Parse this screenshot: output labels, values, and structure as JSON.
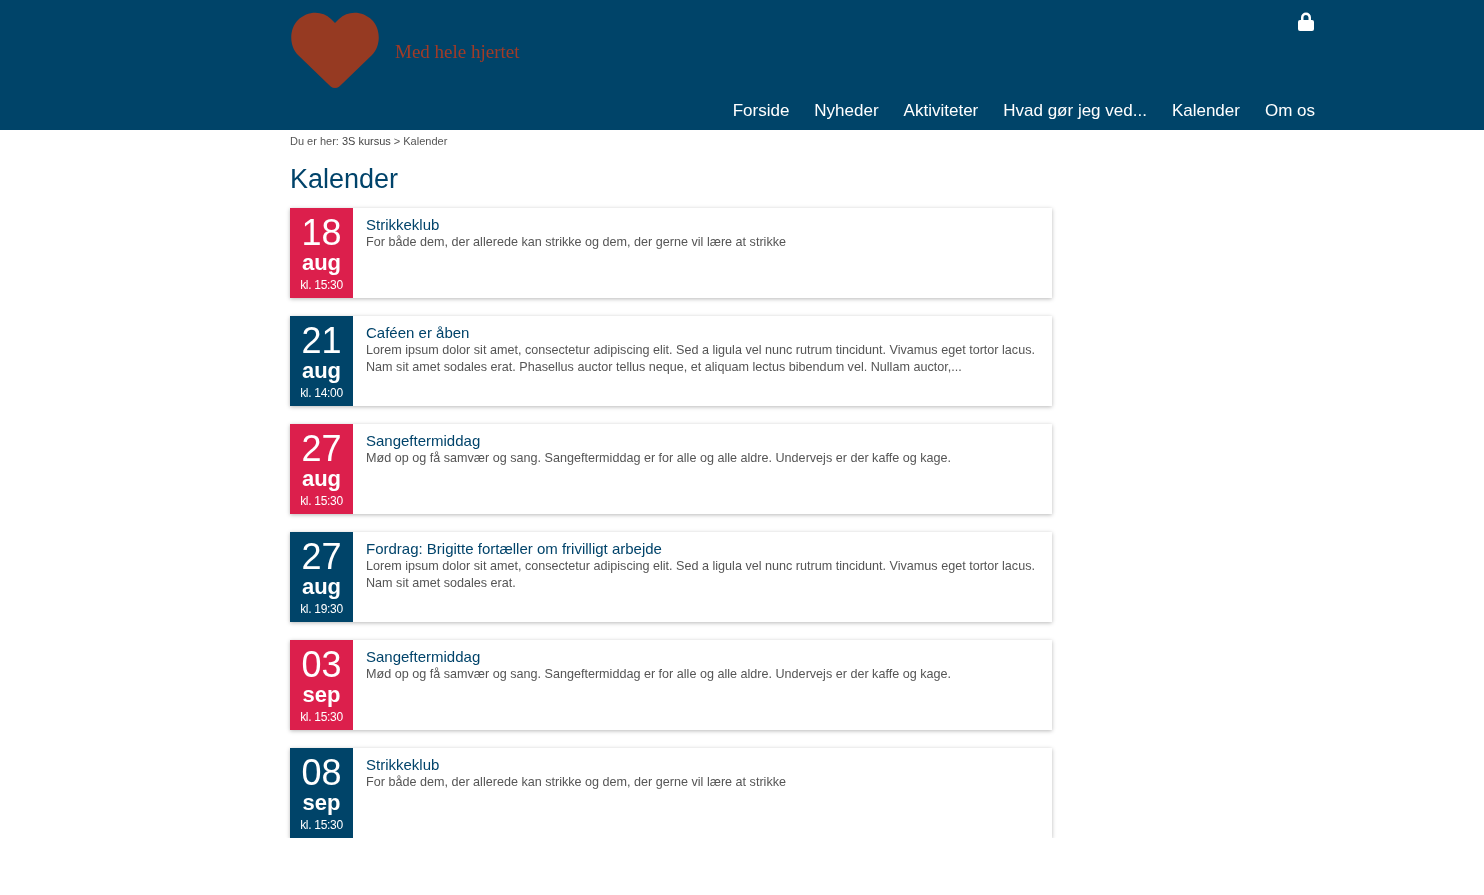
{
  "header": {
    "site_title": "Med hele hjertet",
    "nav": [
      "Forside",
      "Nyheder",
      "Aktiviteter",
      "Hvad gør jeg ved...",
      "Kalender",
      "Om os"
    ]
  },
  "breadcrumb": {
    "prefix": "Du er her:",
    "trail": [
      "3S kursus",
      "Kalender"
    ],
    "separator": ">"
  },
  "page_title": "Kalender",
  "events": [
    {
      "day": "18",
      "month": "aug",
      "time": "kl. 15:30",
      "color": "#dc1f4c",
      "title": "Strikkeklub",
      "description": "For både dem, der allerede kan strikke og dem, der gerne vil lære at strikke"
    },
    {
      "day": "21",
      "month": "aug",
      "time": "kl. 14:00",
      "color": "#004469",
      "title": "Caféen er åben",
      "description": "Lorem ipsum dolor sit amet, consectetur adipiscing elit. Sed a ligula vel nunc rutrum tincidunt. Vivamus eget tortor lacus. Nam sit amet sodales erat. Phasellus auctor tellus neque, et aliquam lectus bibendum vel. Nullam auctor,..."
    },
    {
      "day": "27",
      "month": "aug",
      "time": "kl. 15:30",
      "color": "#dc1f4c",
      "title": "Sangeftermiddag",
      "description": "Mød op og få samvær og sang. Sangeftermiddag er for alle og alle aldre. Undervejs er der kaffe og kage."
    },
    {
      "day": "27",
      "month": "aug",
      "time": "kl. 19:30",
      "color": "#004469",
      "title": "Fordrag: Brigitte fortæller om frivilligt arbejde",
      "description": "Lorem ipsum dolor sit amet, consectetur adipiscing elit. Sed a ligula vel nunc rutrum tincidunt. Vivamus eget tortor lacus. Nam sit amet sodales erat."
    },
    {
      "day": "03",
      "month": "sep",
      "time": "kl. 15:30",
      "color": "#dc1f4c",
      "title": "Sangeftermiddag",
      "description": "Mød op og få samvær og sang. Sangeftermiddag er for alle og alle aldre. Undervejs er der kaffe og kage."
    },
    {
      "day": "08",
      "month": "sep",
      "time": "kl. 15:30",
      "color": "#004469",
      "title": "Strikkeklub",
      "description": "For både dem, der allerede kan strikke og dem, der gerne vil lære at strikke"
    }
  ]
}
